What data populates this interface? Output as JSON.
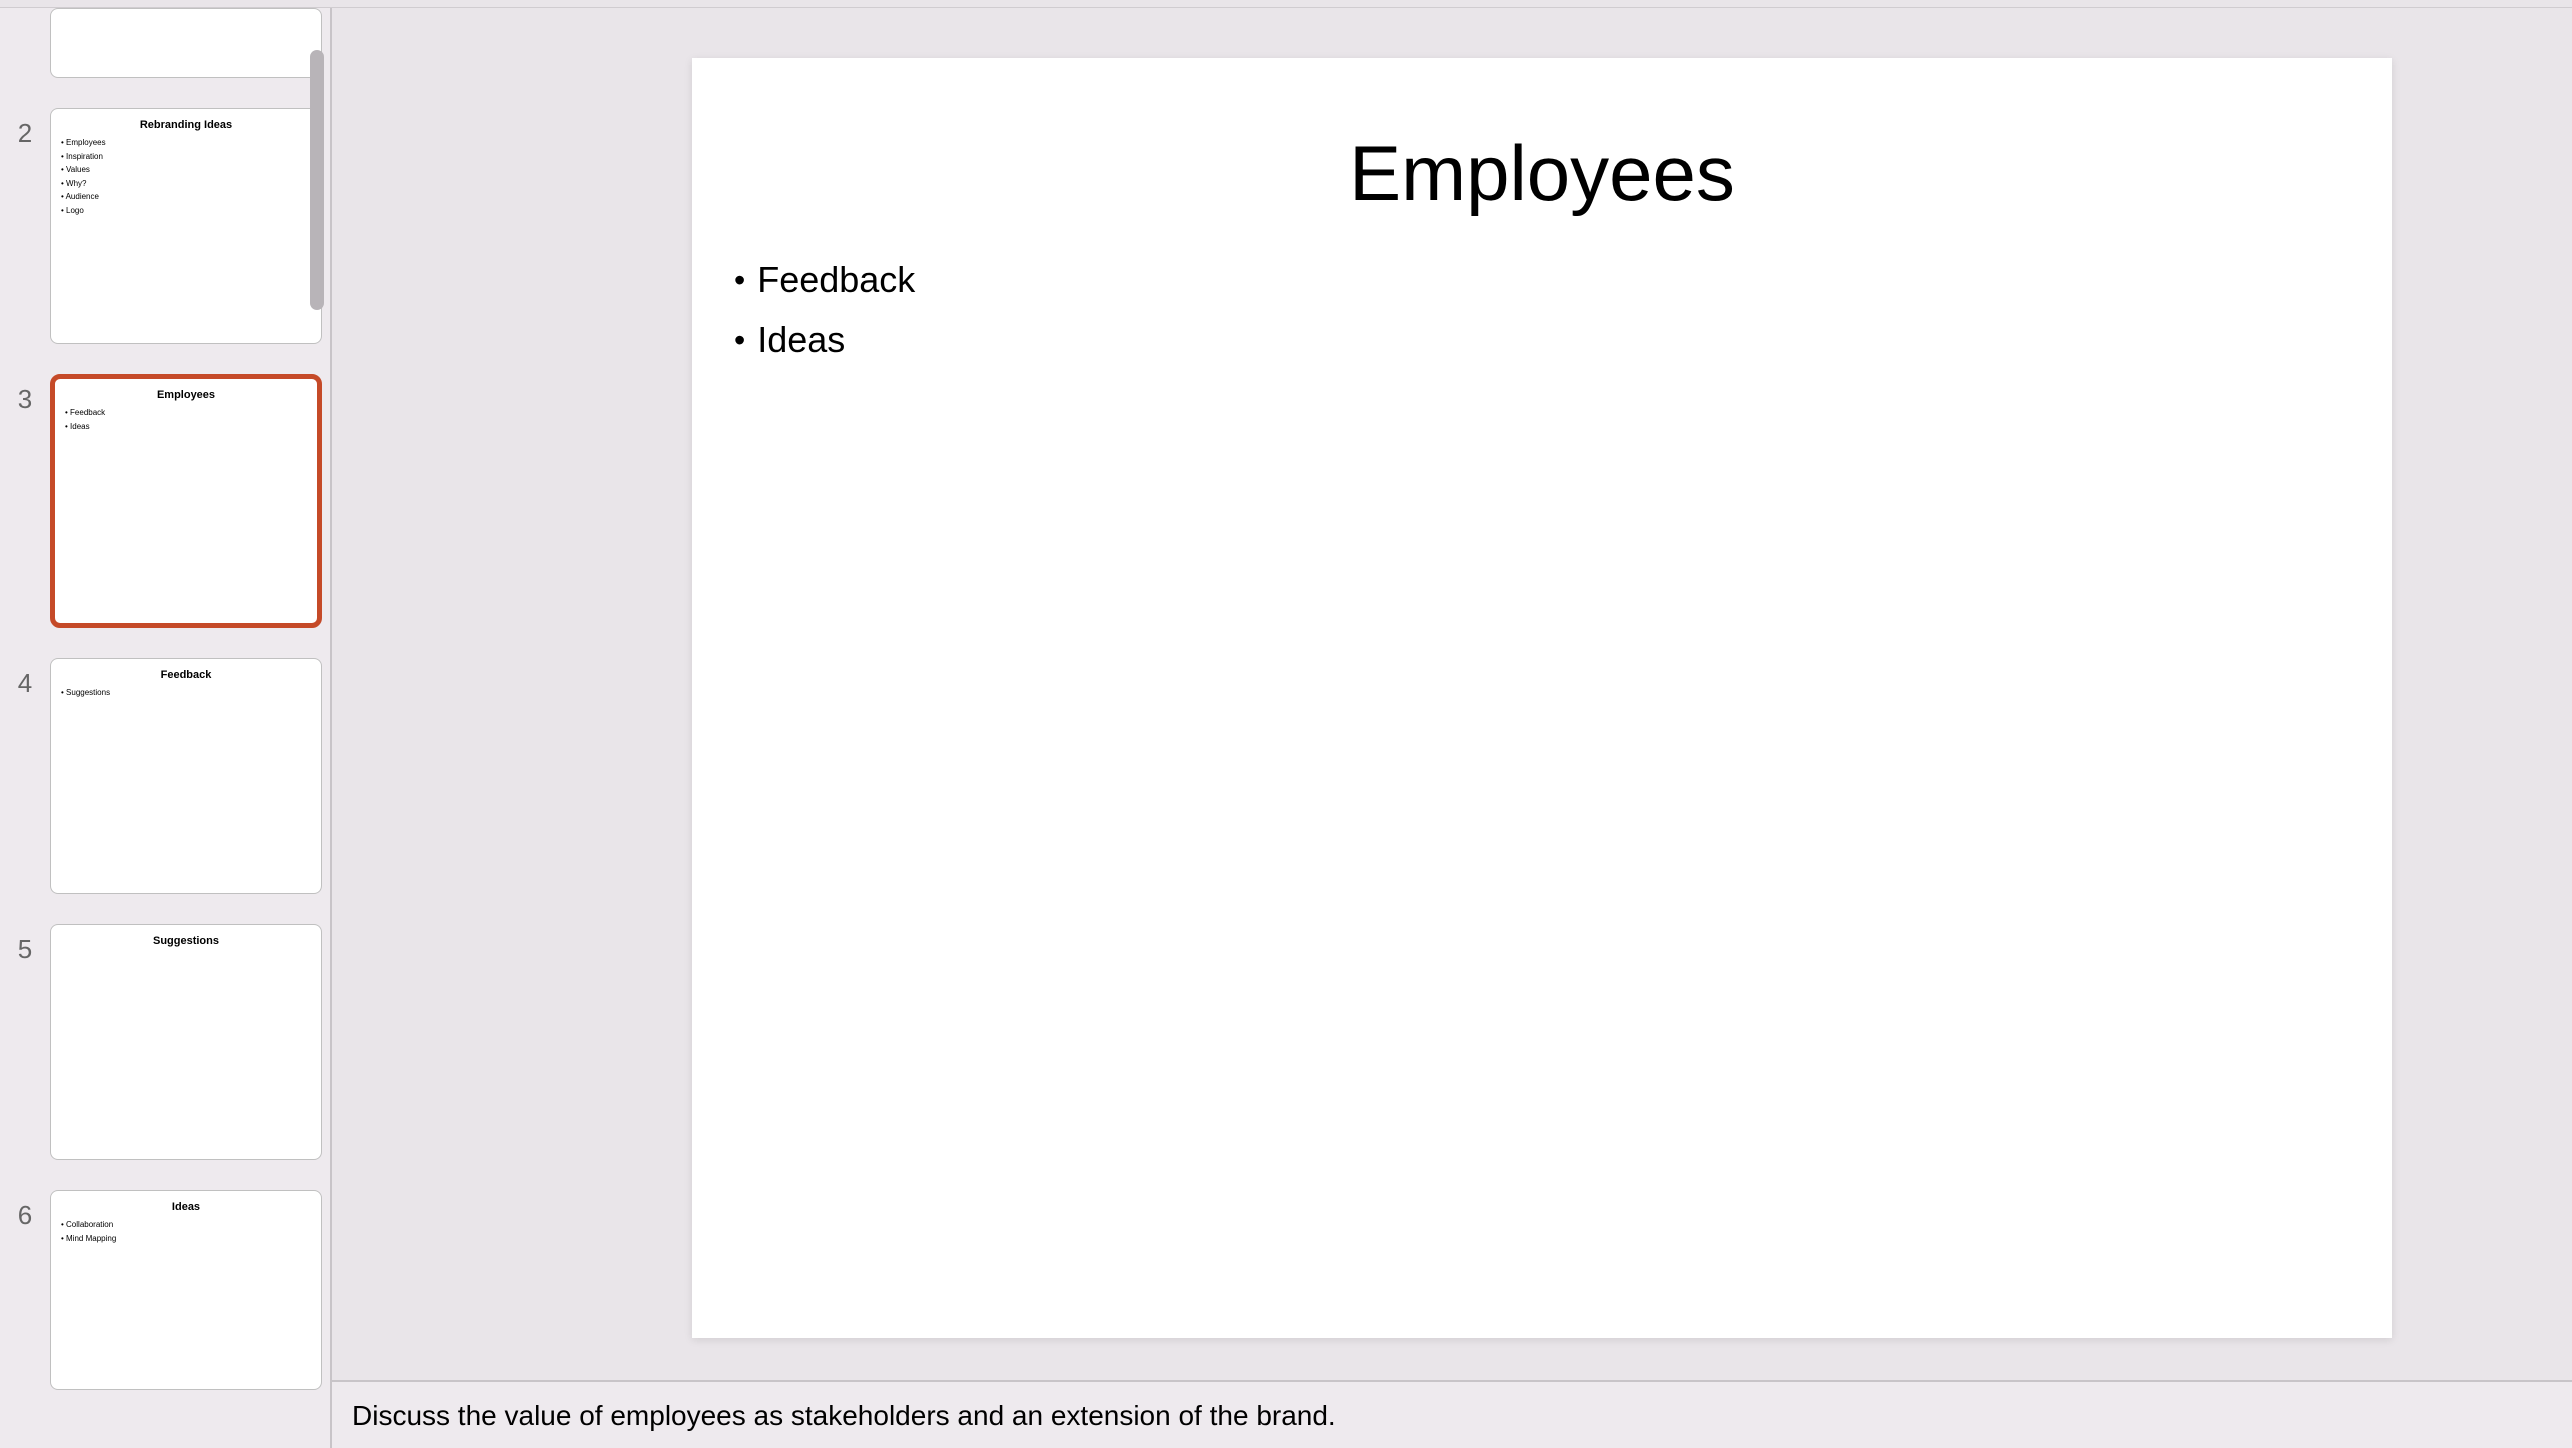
{
  "thumbnails": [
    {
      "number": "",
      "title": "",
      "bullets": [],
      "partial": "top"
    },
    {
      "number": "2",
      "title": "Rebranding Ideas",
      "bullets": [
        "Employees",
        "Inspiration",
        "Values",
        "Why?",
        "Audience",
        "Logo"
      ]
    },
    {
      "number": "3",
      "title": "Employees",
      "bullets": [
        "Feedback",
        "Ideas"
      ],
      "selected": true
    },
    {
      "number": "4",
      "title": "Feedback",
      "bullets": [
        "Suggestions"
      ]
    },
    {
      "number": "5",
      "title": "Suggestions",
      "bullets": []
    },
    {
      "number": "6",
      "title": "Ideas",
      "bullets": [
        "Collaboration",
        "Mind Mapping"
      ],
      "partial": "bottom"
    }
  ],
  "mainSlide": {
    "title": "Employees",
    "bullets": [
      "Feedback",
      "Ideas"
    ]
  },
  "notes": "Discuss the value of employees as stakeholders and an extension of the brand."
}
